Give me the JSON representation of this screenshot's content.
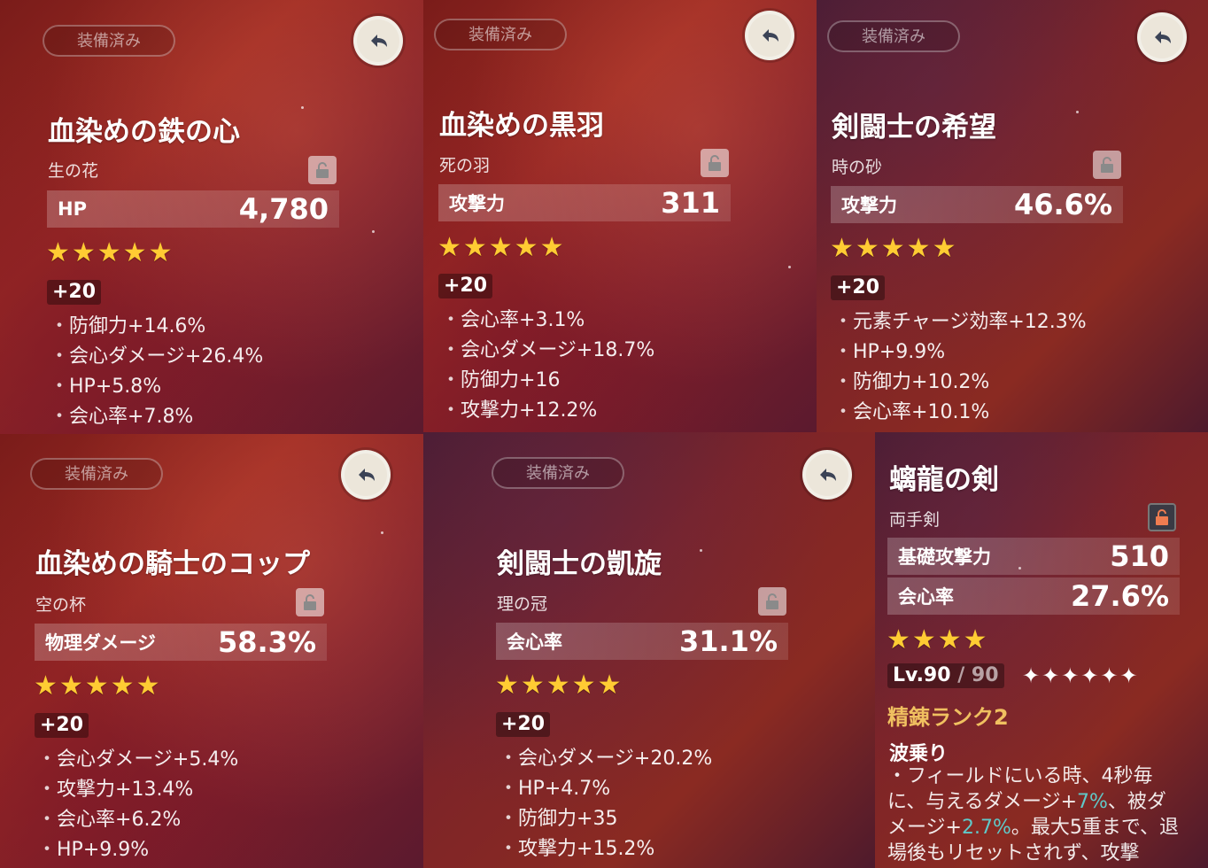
{
  "equipped_label": "装備済み",
  "artifacts": [
    {
      "name": "血染めの鉄の心",
      "slot": "生の花",
      "main_stat": {
        "label": "HP",
        "value": "4,780"
      },
      "rarity": 5,
      "stars": "★★★★★",
      "level": "+20",
      "substats": [
        "防御力+14.6%",
        "会心ダメージ+26.4%",
        "HP+5.8%",
        "会心率+7.8%"
      ]
    },
    {
      "name": "血染めの黒羽",
      "slot": "死の羽",
      "main_stat": {
        "label": "攻撃力",
        "value": "311"
      },
      "rarity": 5,
      "stars": "★★★★★",
      "level": "+20",
      "substats": [
        "会心率+3.1%",
        "会心ダメージ+18.7%",
        "防御力+16",
        "攻撃力+12.2%"
      ]
    },
    {
      "name": "剣闘士の希望",
      "slot": "時の砂",
      "main_stat": {
        "label": "攻撃力",
        "value": "46.6%"
      },
      "rarity": 5,
      "stars": "★★★★★",
      "level": "+20",
      "substats": [
        "元素チャージ効率+12.3%",
        "HP+9.9%",
        "防御力+10.2%",
        "会心率+10.1%"
      ]
    },
    {
      "name": "血染めの騎士のコップ",
      "slot": "空の杯",
      "main_stat": {
        "label": "物理ダメージ",
        "value": "58.3%"
      },
      "rarity": 5,
      "stars": "★★★★★",
      "level": "+20",
      "substats": [
        "会心ダメージ+5.4%",
        "攻撃力+13.4%",
        "会心率+6.2%",
        "HP+9.9%"
      ]
    },
    {
      "name": "剣闘士の凱旋",
      "slot": "理の冠",
      "main_stat": {
        "label": "会心率",
        "value": "31.1%"
      },
      "rarity": 5,
      "stars": "★★★★★",
      "level": "+20",
      "substats": [
        "会心ダメージ+20.2%",
        "HP+4.7%",
        "防御力+35",
        "攻撃力+15.2%"
      ]
    }
  ],
  "weapon": {
    "name": "螭龍の剣",
    "type": "両手剣",
    "stats": [
      {
        "label": "基礎攻撃力",
        "value": "510"
      },
      {
        "label": "会心率",
        "value": "27.6%"
      }
    ],
    "rarity": 4,
    "stars": "★★★★",
    "level": "Lv.90",
    "level_max": "/ 90",
    "ascension": "✦✦✦✦✦✦",
    "refinement": "精錬ランク2",
    "passive_name": "波乗り",
    "passive_desc": {
      "p1": "・フィールドにいる時、4秒毎に、与えるダメージ+",
      "v1": "7%",
      "p2": "、被ダメージ+",
      "v2": "2.7%",
      "p3": "。最大5重まで、退場後もリセットされず、攻撃"
    }
  },
  "icons": {
    "back": "back-arrow-icon",
    "lock": "lock-icon"
  },
  "colors": {
    "star": "#ffcc33",
    "refine": "#f0c060",
    "highlight": "#60c8c8"
  }
}
